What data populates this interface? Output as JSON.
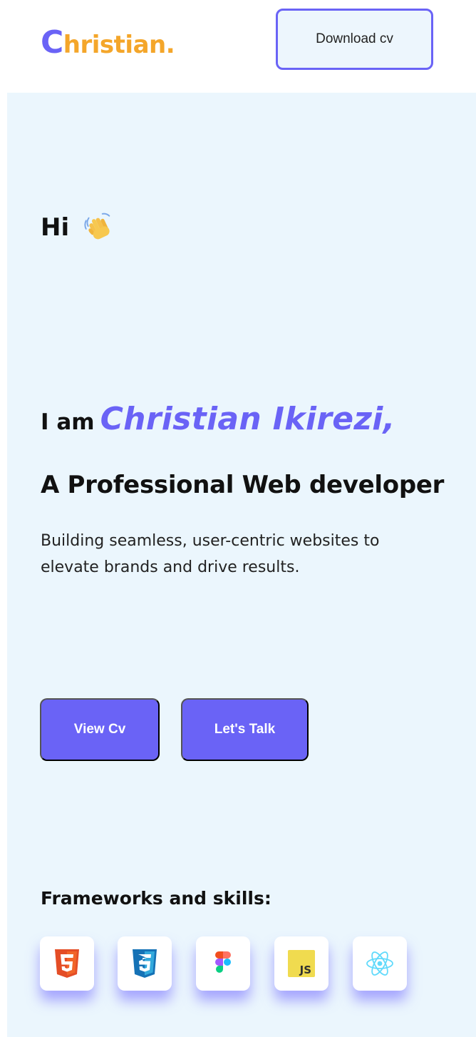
{
  "header": {
    "logo_initial": "C",
    "logo_rest": "hristian.",
    "download_label": "Download cv"
  },
  "hero": {
    "greeting": "Hi",
    "greeting_icon": "waving-hand-icon",
    "intro_prefix": "I am",
    "name": "Christian Ikirezi,",
    "role": "A Professional Web developer",
    "tagline": "Building seamless, user-centric websites to elevate brands and drive results.",
    "buttons": {
      "view_cv": "View Cv",
      "lets_talk": "Let's Talk"
    }
  },
  "skills": {
    "title": "Frameworks and skills:",
    "items": [
      {
        "icon": "html5-icon",
        "label": "5",
        "color": "#e44d26"
      },
      {
        "icon": "css3-icon",
        "label": "3",
        "color": "#1572b6"
      },
      {
        "icon": "figma-icon",
        "color": "#a259ff"
      },
      {
        "icon": "javascript-icon",
        "label": "JS",
        "color": "#f0db4f"
      },
      {
        "icon": "react-icon",
        "color": "#61dafb"
      }
    ]
  },
  "colors": {
    "accent": "#6a63f6",
    "logo_secondary": "#f4a62a",
    "hero_background": "#ebf6fd"
  }
}
